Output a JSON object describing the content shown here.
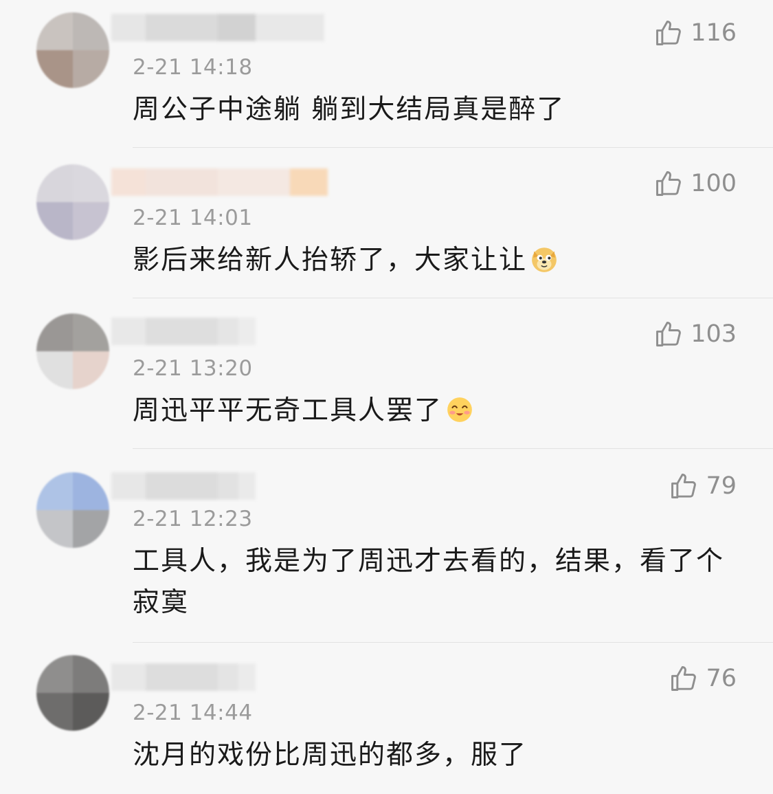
{
  "comments": [
    {
      "time": "2-21 14:18",
      "text": "周公子中途躺  躺到大结局真是醉了",
      "likes": "116",
      "avatar_colors": [
        "#c9c3bf",
        "#bdb8b5",
        "#a99488",
        "#b7aba4"
      ],
      "name_blur_colors": [
        "#e6e6e6",
        "#dadada",
        "#d2d2d2",
        "#e8e8e8"
      ],
      "emoji": ""
    },
    {
      "time": "2-21 14:01",
      "text": "影后来给新人抬轿了，大家让让",
      "likes": "100",
      "avatar_colors": [
        "#d8d6dc",
        "#dad8de",
        "#b9b6c8",
        "#c7c3d1"
      ],
      "name_blur_colors": [
        "#f5e2d8",
        "#f2e3dc",
        "#f4e8e2",
        "#f8d9b8"
      ],
      "emoji": "doge-emoji"
    },
    {
      "time": "2-21 13:20",
      "text": "周迅平平无奇工具人罢了",
      "likes": "103",
      "avatar_colors": [
        "#9a9795",
        "#a3a19e",
        "#e0e0e0",
        "#e6d3cc"
      ],
      "name_blur_colors": [
        "#e8e8e8",
        "#dedede",
        "#e5e5e5",
        "#ececec"
      ],
      "emoji": "blush-emoji"
    },
    {
      "time": "2-21 12:23",
      "text": "工具人，我是为了周迅才去看的，结果，看了个寂寞",
      "likes": "79",
      "avatar_colors": [
        "#aec3e6",
        "#9db4e0",
        "#c4c5c8",
        "#a3a4a6"
      ],
      "name_blur_colors": [
        "#e7e7e7",
        "#dcdcdc",
        "#e2e2e2",
        "#eaeaea"
      ],
      "emoji": ""
    },
    {
      "time": "2-21 14:44",
      "text": "沈月的戏份比周迅的都多，服了",
      "likes": "76",
      "avatar_colors": [
        "#8f8e8d",
        "#7d7c7b",
        "#6e6d6c",
        "#5c5b5a"
      ],
      "name_blur_colors": [
        "#e8e8e8",
        "#dddddd",
        "#e4e4e4",
        "#ebebeb"
      ],
      "emoji": ""
    }
  ],
  "colors": {
    "background": "#f7f7f7",
    "text": "#1a1a1a",
    "meta": "#9b9b9b",
    "divider": "#e2e2e2"
  },
  "icons": {
    "like": "thumbs-up-icon"
  }
}
